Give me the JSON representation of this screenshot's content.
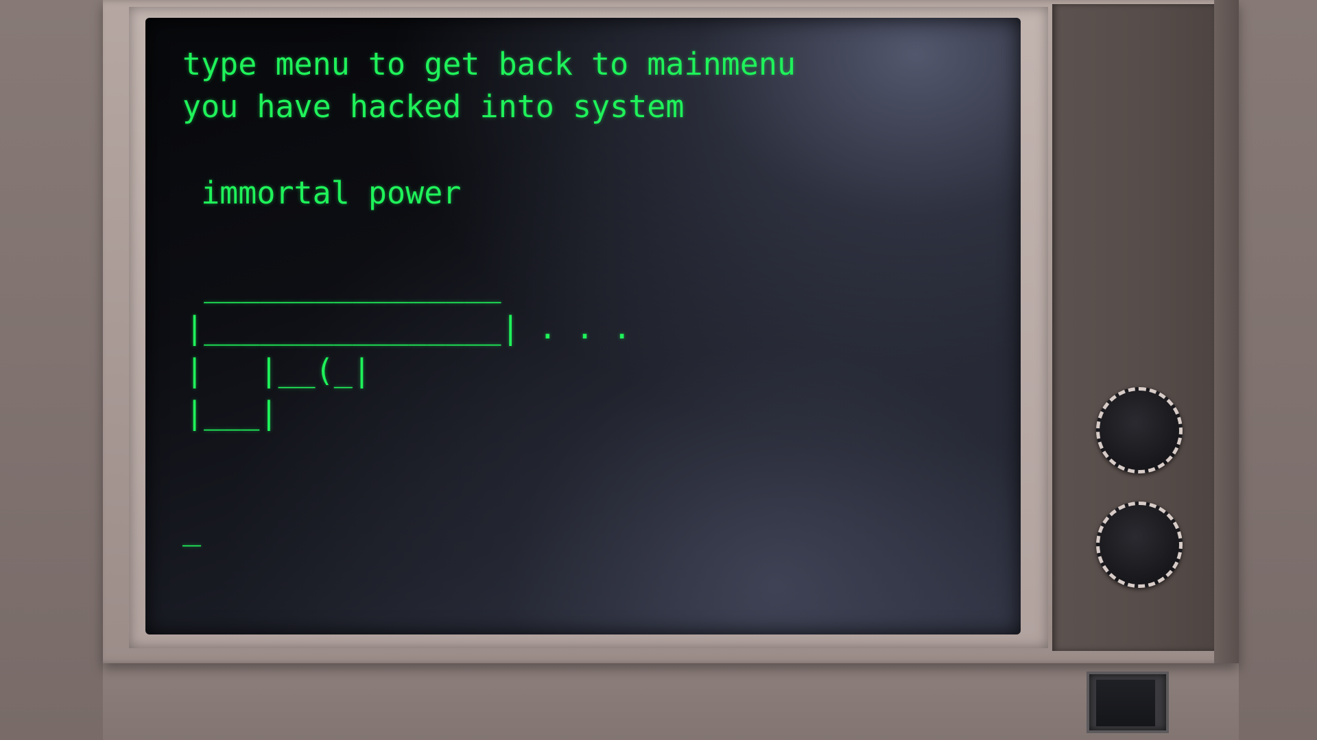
{
  "terminal": {
    "line1": "type menu to get back to mainmenu",
    "line2": "you have hacked into system",
    "item": " immortal power",
    "ascii_art": " ________________\n|________________| . . .\n|   |__(_|\n|___|",
    "cursor": "_"
  },
  "controls": {
    "knob_top_icon": "dial-knob",
    "knob_bottom_icon": "dial-knob",
    "power_icon": "square-button"
  },
  "colors": {
    "terminal_text": "#1ff25a",
    "screen_bg": "#0d0e13",
    "bezel": "#b2a39f",
    "panel": "#564c49"
  }
}
